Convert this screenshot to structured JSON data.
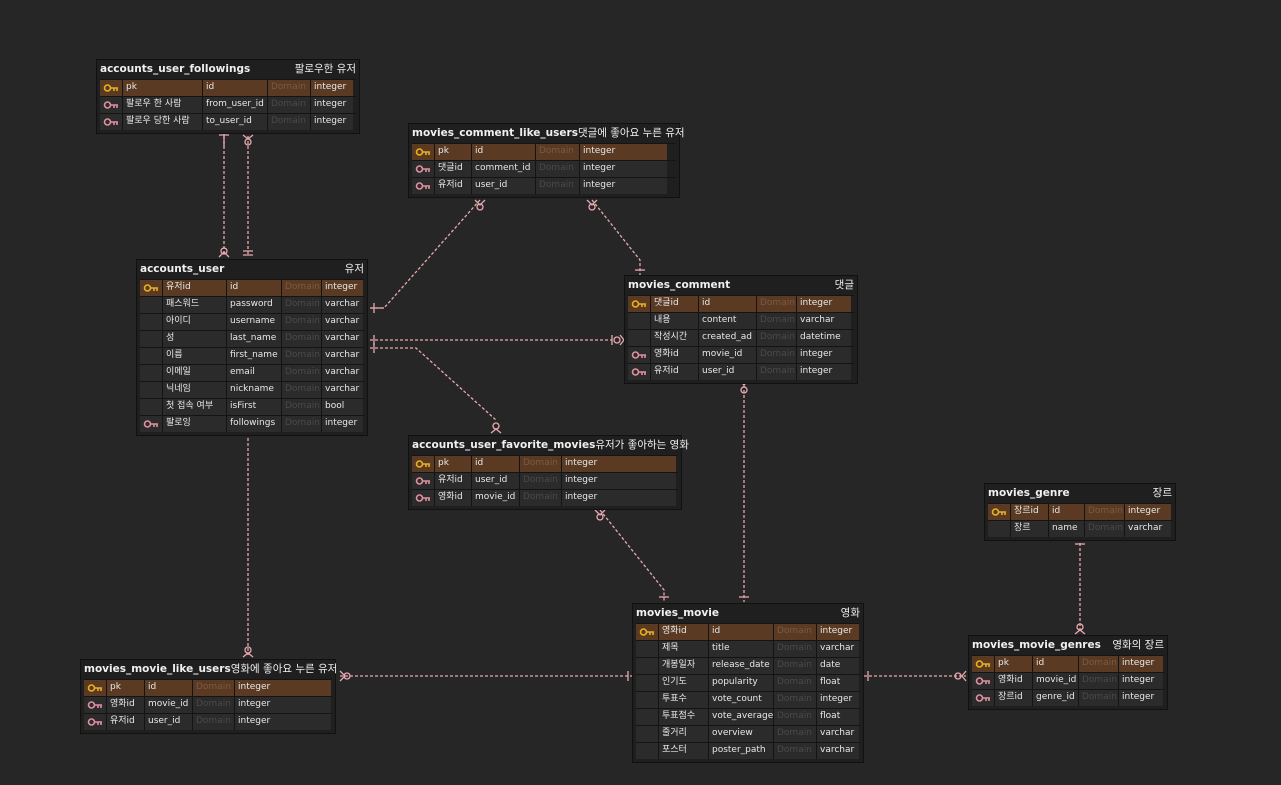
{
  "colors": {
    "background": "#262626",
    "pk_row": "#5a3a22",
    "relation_line": "#e8a8b0",
    "pk_icon": "#e8b020",
    "fk_icon": "#e090a0"
  },
  "domain_placeholder": "Domain",
  "tables": {
    "accounts_user_followings": {
      "name": "accounts_user_followings",
      "label": "팔로우한 유저",
      "rows": [
        {
          "key": "pk",
          "logical": "pk",
          "physical": "id",
          "type": "integer"
        },
        {
          "key": "fk",
          "logical": "팔로우 한 사람",
          "physical": "from_user_id",
          "type": "integer"
        },
        {
          "key": "fk",
          "logical": "팔로우 당한 사람",
          "physical": "to_user_id",
          "type": "integer"
        }
      ]
    },
    "movies_comment_like_users": {
      "name": "movies_comment_like_users",
      "label": "댓글에 좋아요 누른 유저",
      "rows": [
        {
          "key": "pk",
          "logical": "pk",
          "physical": "id",
          "type": "integer"
        },
        {
          "key": "fk",
          "logical": "댓글id",
          "physical": "comment_id",
          "type": "integer"
        },
        {
          "key": "fk",
          "logical": "유저id",
          "physical": "user_id",
          "type": "integer"
        }
      ]
    },
    "accounts_user": {
      "name": "accounts_user",
      "label": "유저",
      "rows": [
        {
          "key": "pk",
          "logical": "유저id",
          "physical": "id",
          "type": "integer"
        },
        {
          "key": "",
          "logical": "패스워드",
          "physical": "password",
          "type": "varchar"
        },
        {
          "key": "",
          "logical": "아이디",
          "physical": "username",
          "type": "varchar"
        },
        {
          "key": "",
          "logical": "성",
          "physical": "last_name",
          "type": "varchar"
        },
        {
          "key": "",
          "logical": "이름",
          "physical": "first_name",
          "type": "varchar"
        },
        {
          "key": "",
          "logical": "이메일",
          "physical": "email",
          "type": "varchar"
        },
        {
          "key": "",
          "logical": "닉네임",
          "physical": "nickname",
          "type": "varchar"
        },
        {
          "key": "",
          "logical": "첫 접속 여부",
          "physical": "isFirst",
          "type": "bool"
        },
        {
          "key": "fk",
          "logical": "팔로잉",
          "physical": "followings",
          "type": "integer"
        }
      ]
    },
    "movies_comment": {
      "name": "movies_comment",
      "label": "댓글",
      "rows": [
        {
          "key": "pk",
          "logical": "댓글id",
          "physical": "id",
          "type": "integer"
        },
        {
          "key": "",
          "logical": "내용",
          "physical": "content",
          "type": "varchar"
        },
        {
          "key": "",
          "logical": "작성시간",
          "physical": "created_ad",
          "type": "datetime"
        },
        {
          "key": "fk",
          "logical": "영화id",
          "physical": "movie_id",
          "type": "integer"
        },
        {
          "key": "fk",
          "logical": "유저id",
          "physical": "user_id",
          "type": "integer"
        }
      ]
    },
    "accounts_user_favorite_movies": {
      "name": "accounts_user_favorite_movies",
      "label": "유저가 좋아하는 영화",
      "rows": [
        {
          "key": "pk",
          "logical": "pk",
          "physical": "id",
          "type": "integer"
        },
        {
          "key": "fk",
          "logical": "유저id",
          "physical": "user_id",
          "type": "integer"
        },
        {
          "key": "fk",
          "logical": "영화id",
          "physical": "movie_id",
          "type": "integer"
        }
      ]
    },
    "movies_genre": {
      "name": "movies_genre",
      "label": "장르",
      "rows": [
        {
          "key": "pk",
          "logical": "장르id",
          "physical": "id",
          "type": "integer"
        },
        {
          "key": "",
          "logical": "장르",
          "physical": "name",
          "type": "varchar"
        }
      ]
    },
    "movies_movie": {
      "name": "movies_movie",
      "label": "영화",
      "rows": [
        {
          "key": "pk",
          "logical": "영화id",
          "physical": "id",
          "type": "integer"
        },
        {
          "key": "",
          "logical": "제목",
          "physical": "title",
          "type": "varchar"
        },
        {
          "key": "",
          "logical": "개봉일자",
          "physical": "release_date",
          "type": "date"
        },
        {
          "key": "",
          "logical": "인기도",
          "physical": "popularity",
          "type": "float"
        },
        {
          "key": "",
          "logical": "투표수",
          "physical": "vote_count",
          "type": "integer"
        },
        {
          "key": "",
          "logical": "투표점수",
          "physical": "vote_average",
          "type": "float"
        },
        {
          "key": "",
          "logical": "줄거리",
          "physical": "overview",
          "type": "varchar"
        },
        {
          "key": "",
          "logical": "포스터",
          "physical": "poster_path",
          "type": "varchar"
        }
      ]
    },
    "movies_movie_like_users": {
      "name": "movies_movie_like_users",
      "label": "영화에 좋아요 누른 유저",
      "rows": [
        {
          "key": "pk",
          "logical": "pk",
          "physical": "id",
          "type": "integer"
        },
        {
          "key": "fk",
          "logical": "영화id",
          "physical": "movie_id",
          "type": "integer"
        },
        {
          "key": "fk",
          "logical": "유저id",
          "physical": "user_id",
          "type": "integer"
        }
      ]
    },
    "movies_movie_genres": {
      "name": "movies_movie_genres",
      "label": "영화의 장르",
      "rows": [
        {
          "key": "pk",
          "logical": "pk",
          "physical": "id",
          "type": "integer"
        },
        {
          "key": "fk",
          "logical": "영화id",
          "physical": "movie_id",
          "type": "integer"
        },
        {
          "key": "fk",
          "logical": "장르id",
          "physical": "genre_id",
          "type": "integer"
        }
      ]
    }
  }
}
